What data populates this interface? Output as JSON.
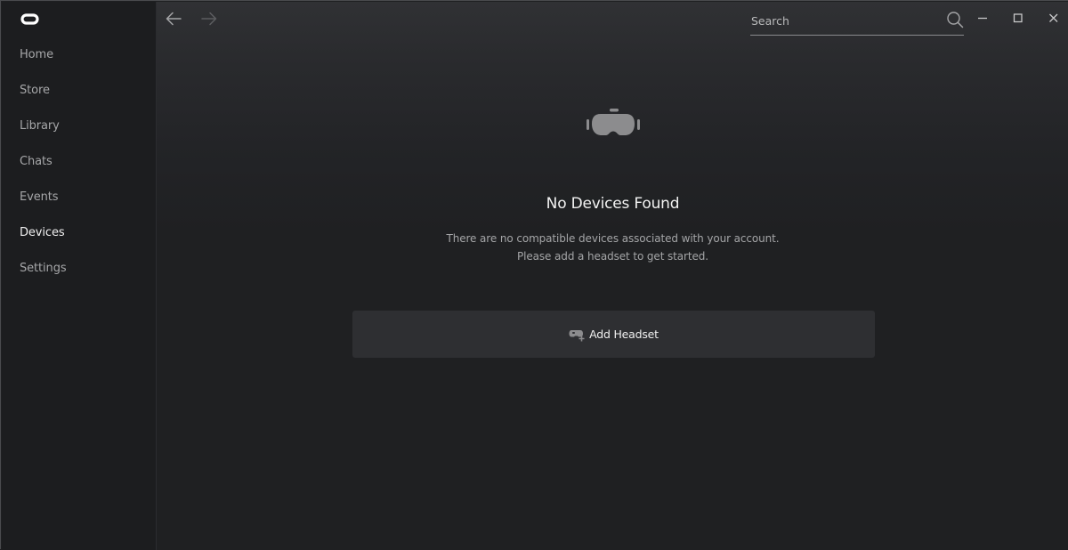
{
  "app": {
    "logo_icon": "oculus-logo-icon"
  },
  "sidebar": {
    "items": [
      {
        "label": "Home",
        "active": false
      },
      {
        "label": "Store",
        "active": false
      },
      {
        "label": "Library",
        "active": false
      },
      {
        "label": "Chats",
        "active": false
      },
      {
        "label": "Events",
        "active": false
      },
      {
        "label": "Devices",
        "active": true
      },
      {
        "label": "Settings",
        "active": false
      }
    ]
  },
  "titlebar": {
    "back_icon": "arrow-left-icon",
    "forward_icon": "arrow-right-icon",
    "search": {
      "placeholder": "Search",
      "value": "",
      "icon": "search-icon"
    },
    "window_controls": [
      "minimize-icon",
      "maximize-icon",
      "close-icon"
    ]
  },
  "main": {
    "empty_state_icon": "vr-headset-icon",
    "title": "No Devices Found",
    "description_line1": "There are no compatible devices associated with your account.",
    "description_line2": "Please add a headset to get started.",
    "add_button": {
      "label": "Add Headset",
      "icon": "add-headset-icon"
    }
  },
  "colors": {
    "background": "#1f2022",
    "sidebar": "#1c1d1f",
    "button": "#2e2f32",
    "text_primary": "#f0f0f0",
    "text_secondary": "#a6a7a9",
    "icon_gray": "#8c8c8e"
  }
}
